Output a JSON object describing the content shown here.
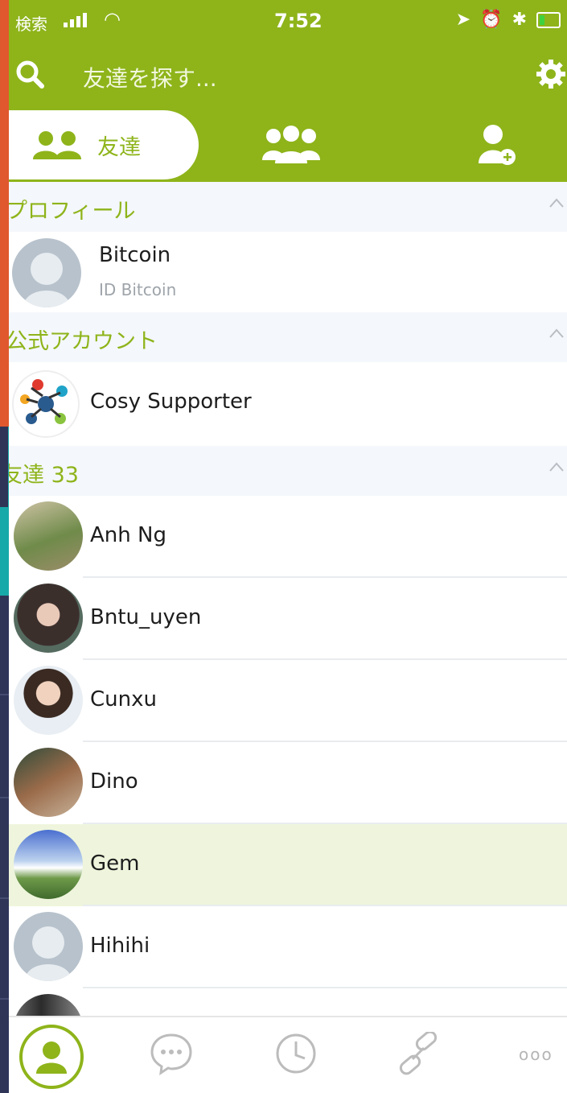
{
  "status_bar": {
    "carrier": "検索",
    "time": "7:52"
  },
  "search": {
    "placeholder": "友達を探す..."
  },
  "tabs": {
    "friends_label": "友達"
  },
  "sections": {
    "profile": "プロフィール",
    "official": "公式アカウント",
    "friends": "友達 33"
  },
  "profile": {
    "name": "Bitcoin",
    "id": "ID Bitcoin"
  },
  "official_accounts": [
    {
      "name": "Cosy Supporter"
    }
  ],
  "friends": [
    {
      "name": "Anh Ng"
    },
    {
      "name": "Bntu_uyen"
    },
    {
      "name": "Cunxu"
    },
    {
      "name": "Dino"
    },
    {
      "name": "Gem",
      "highlighted": true
    },
    {
      "name": "Hihihi"
    }
  ],
  "bottom_nav": {
    "more": "ooo"
  },
  "colors": {
    "brand": "#8eb41a",
    "highlight_row": "#eef5dc",
    "section_bg": "#f4f7fb"
  }
}
